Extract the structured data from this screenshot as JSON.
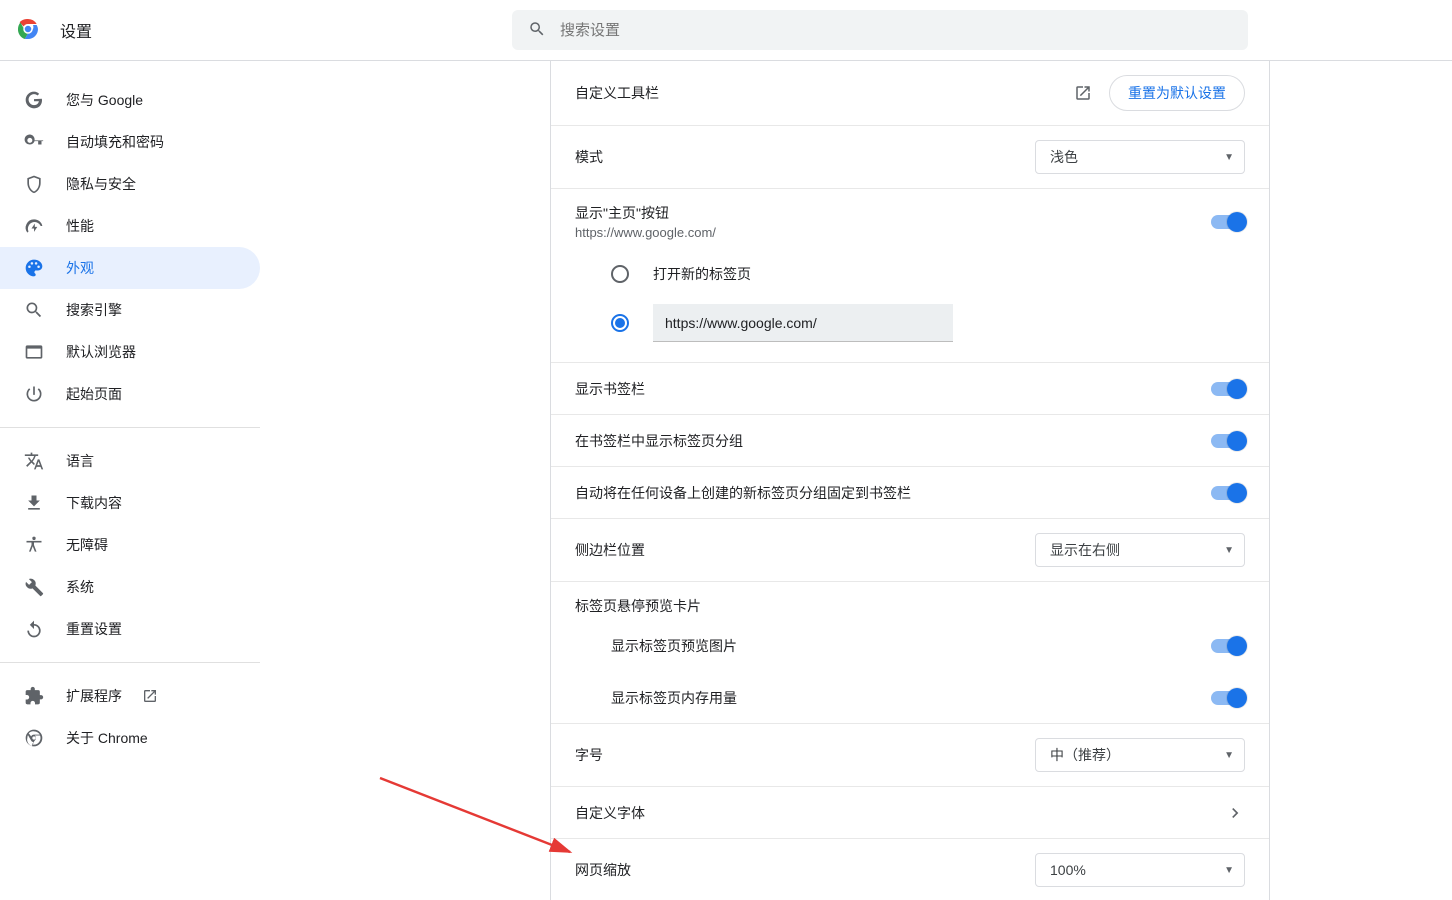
{
  "header": {
    "title": "设置",
    "search_placeholder": "搜索设置"
  },
  "sidebar": {
    "items": [
      {
        "label": "您与 Google"
      },
      {
        "label": "自动填充和密码"
      },
      {
        "label": "隐私与安全"
      },
      {
        "label": "性能"
      },
      {
        "label": "外观"
      },
      {
        "label": "搜索引擎"
      },
      {
        "label": "默认浏览器"
      },
      {
        "label": "起始页面"
      }
    ],
    "items2": [
      {
        "label": "语言"
      },
      {
        "label": "下载内容"
      },
      {
        "label": "无障碍"
      },
      {
        "label": "系统"
      },
      {
        "label": "重置设置"
      }
    ],
    "items3": [
      {
        "label": "扩展程序"
      },
      {
        "label": "关于 Chrome"
      }
    ]
  },
  "settings": {
    "toolbar": {
      "label": "自定义工具栏",
      "reset": "重置为默认设置"
    },
    "mode": {
      "label": "模式",
      "value": "浅色"
    },
    "home_button": {
      "label": "显示\"主页\"按钮",
      "url": "https://www.google.com/"
    },
    "home_options": {
      "new_tab": "打开新的标签页",
      "custom_url": "https://www.google.com/"
    },
    "show_bookmarks": "显示书签栏",
    "show_tab_groups": "在书签栏中显示标签页分组",
    "pin_tab_groups": "自动将在任何设备上创建的新标签页分组固定到书签栏",
    "sidebar_pos": {
      "label": "侧边栏位置",
      "value": "显示在右侧"
    },
    "hover_cards": {
      "title": "标签页悬停预览卡片",
      "show_image": "显示标签页预览图片",
      "show_memory": "显示标签页内存用量"
    },
    "font_size": {
      "label": "字号",
      "value": "中（推荐）"
    },
    "custom_font": "自定义字体",
    "page_zoom": {
      "label": "网页缩放",
      "value": "100%"
    }
  }
}
